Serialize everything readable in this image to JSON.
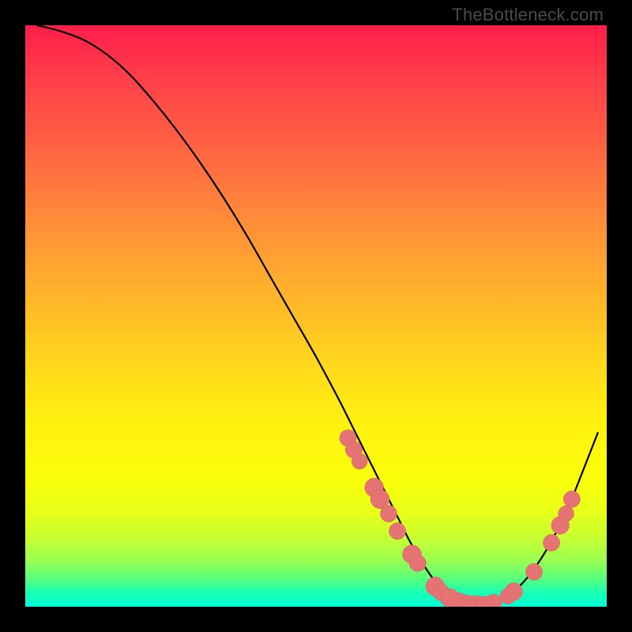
{
  "watermark": "TheBottleneck.com",
  "colors": {
    "curve_stroke": "#000000",
    "marker_fill": "#e57373",
    "marker_stroke": "#d46666",
    "background": "#000000"
  },
  "chart_data": {
    "type": "line",
    "title": "",
    "xlabel": "",
    "ylabel": "",
    "xlim": [
      0,
      100
    ],
    "ylim": [
      0,
      100
    ],
    "series": [
      {
        "name": "curve",
        "x": [
          2,
          6,
          10,
          14,
          18,
          22,
          26,
          30,
          34,
          38,
          42,
          46,
          50,
          54,
          56,
          58,
          60,
          62,
          64,
          66,
          68,
          70,
          72,
          74,
          76,
          78,
          80,
          82,
          84,
          86,
          88,
          90,
          92,
          94,
          96,
          98.5
        ],
        "y": [
          100,
          99,
          97.5,
          95,
          91.5,
          87,
          82,
          76.5,
          70.5,
          64,
          57,
          50,
          43,
          35.5,
          31.5,
          27.5,
          23.5,
          19.5,
          15.5,
          11.5,
          8,
          5,
          2.8,
          1.4,
          0.6,
          0.3,
          0.5,
          1.2,
          2.6,
          4.6,
          7.2,
          10.4,
          14.2,
          18.6,
          23.6,
          30
        ]
      }
    ],
    "markers": [
      {
        "x": 55.5,
        "y": 29,
        "r": 1.0
      },
      {
        "x": 56.5,
        "y": 27,
        "r": 1.0
      },
      {
        "x": 57.5,
        "y": 25,
        "r": 0.9
      },
      {
        "x": 60.0,
        "y": 20.5,
        "r": 1.2
      },
      {
        "x": 61.0,
        "y": 18.5,
        "r": 1.2
      },
      {
        "x": 62.5,
        "y": 16,
        "r": 1.0
      },
      {
        "x": 64.0,
        "y": 13,
        "r": 1.0
      },
      {
        "x": 66.5,
        "y": 9,
        "r": 1.2
      },
      {
        "x": 67.5,
        "y": 7.5,
        "r": 1.0
      },
      {
        "x": 70.5,
        "y": 3.5,
        "r": 1.2
      },
      {
        "x": 71.5,
        "y": 2.5,
        "r": 1.0
      },
      {
        "x": 73.0,
        "y": 1.5,
        "r": 1.2
      },
      {
        "x": 74.5,
        "y": 0.9,
        "r": 1.1
      },
      {
        "x": 76.0,
        "y": 0.5,
        "r": 1.1
      },
      {
        "x": 77.5,
        "y": 0.4,
        "r": 1.1
      },
      {
        "x": 79.0,
        "y": 0.4,
        "r": 1.0
      },
      {
        "x": 80.5,
        "y": 0.7,
        "r": 1.0
      },
      {
        "x": 83.0,
        "y": 1.8,
        "r": 0.9
      },
      {
        "x": 84.0,
        "y": 2.6,
        "r": 1.1
      },
      {
        "x": 87.5,
        "y": 6,
        "r": 1.0
      },
      {
        "x": 90.5,
        "y": 11,
        "r": 1.0
      },
      {
        "x": 92.0,
        "y": 14,
        "r": 1.1
      },
      {
        "x": 93.0,
        "y": 16,
        "r": 0.9
      },
      {
        "x": 94.0,
        "y": 18.5,
        "r": 1.0
      }
    ]
  }
}
